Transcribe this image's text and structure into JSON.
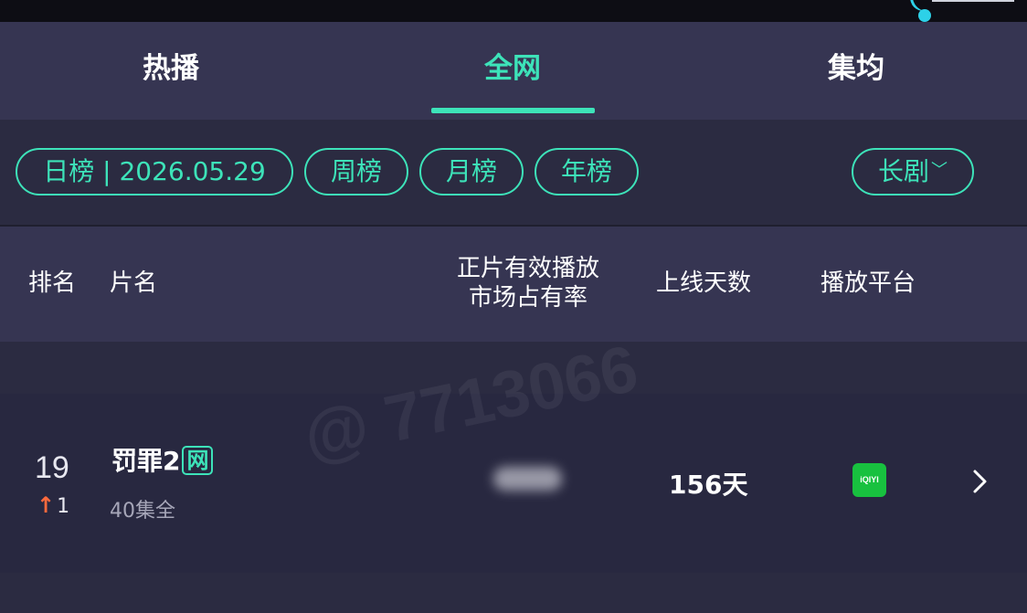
{
  "tabs": [
    {
      "label": "热播"
    },
    {
      "label": "全网"
    },
    {
      "label": "集均"
    }
  ],
  "filters": {
    "daily": "日榜 | 2026.05.29",
    "weekly": "周榜",
    "monthly": "月榜",
    "yearly": "年榜",
    "genre": "长剧"
  },
  "table_header": {
    "rank": "排名",
    "title": "片名",
    "share_line1": "正片有效播放",
    "share_line2": "市场占有率",
    "days": "上线天数",
    "platform": "播放平台"
  },
  "rows": [
    {
      "rank": "19",
      "rank_change": "1",
      "title": "罚罪2",
      "badge": "网",
      "episodes": "40集全",
      "days": "156天",
      "platform_icon": "iqiyi-icon",
      "platform_label": "iQIYI"
    }
  ],
  "watermark": "@ 7713066",
  "colors": {
    "accent": "#3de3b9",
    "rank_up": "#ff6a3d",
    "platform_green": "#18c13f"
  }
}
